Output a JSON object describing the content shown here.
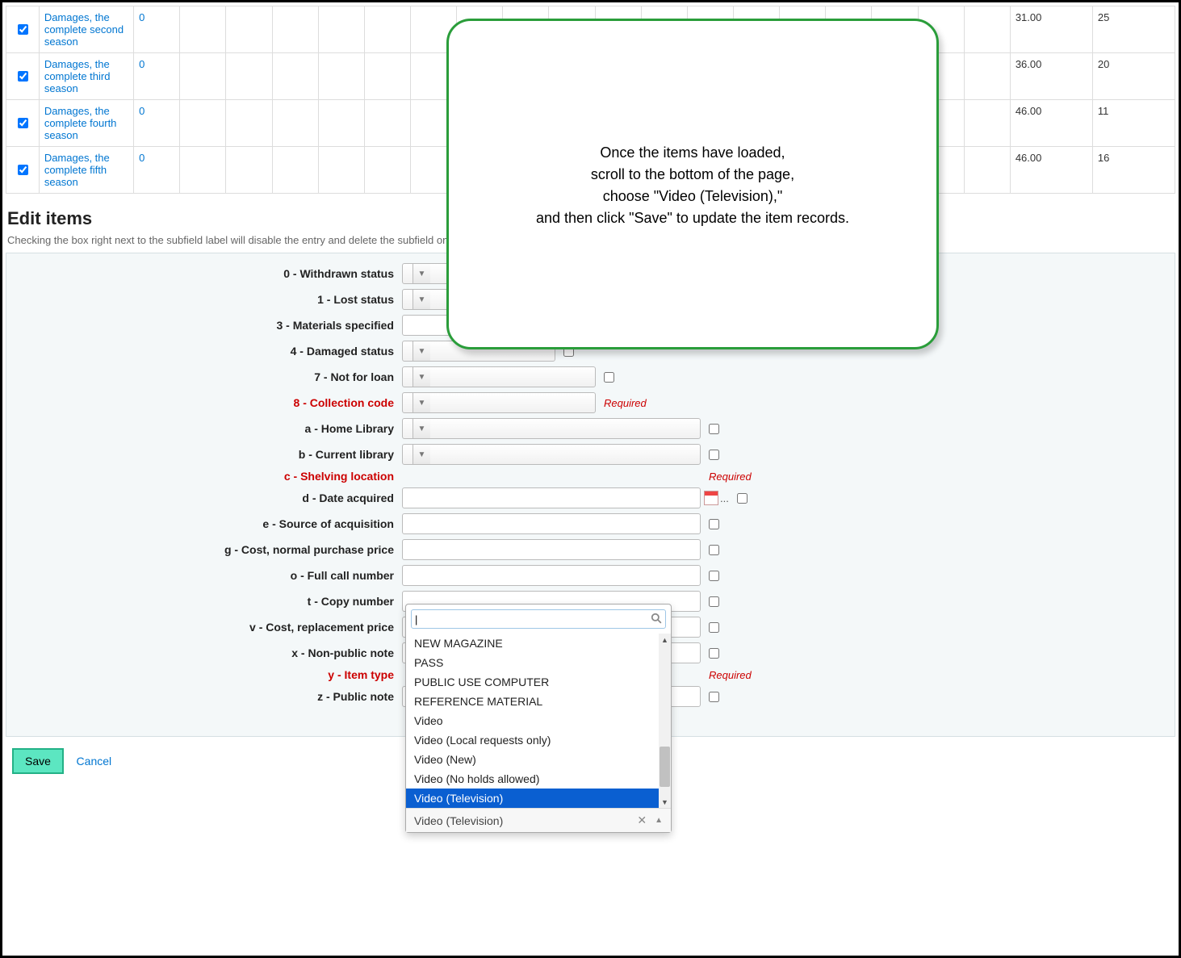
{
  "callout": {
    "line1": "Once the items have loaded,",
    "line2": "scroll to the bottom of the page,",
    "line3": "choose \"Video (Television),\"",
    "line4": "and then click \"Save\" to update the item records."
  },
  "table_rows": [
    {
      "title": "Damages, the complete second season",
      "qty": "0",
      "price": "31.00",
      "count": "25"
    },
    {
      "title": "Damages, the complete third season",
      "qty": "0",
      "price": "36.00",
      "count": "20"
    },
    {
      "title": "Damages, the complete fourth season",
      "qty": "0",
      "price": "46.00",
      "count": "11"
    },
    {
      "title": "Damages, the complete fifth season",
      "qty": "0",
      "price": "46.00",
      "count": "16"
    }
  ],
  "section_title": "Edit items",
  "help_text": "Checking the box right next to the subfield label will disable the entry and delete the subfield on all selected items. Leave fields blank to make no change.",
  "required_text": "Required",
  "fields": {
    "f0": "0 - Withdrawn status",
    "f1": "1 - Lost status",
    "f3": "3 - Materials specified",
    "f4": "4 - Damaged status",
    "f7": "7 - Not for loan",
    "f8": "8 - Collection code",
    "fa": "a - Home Library",
    "fb": "b - Current library",
    "fc": "c - Shelving location",
    "fd": "d - Date acquired",
    "fe": "e - Source of acquisition",
    "fg": "g - Cost, normal purchase price",
    "fo": "o - Full call number",
    "ft": "t - Copy number",
    "fv": "v - Cost, replacement price",
    "fx": "x - Non-public note",
    "fy": "y - Item type",
    "fz": "z - Public note"
  },
  "combo": {
    "selected_display": "Video (Television)",
    "options": [
      "NEW MAGAZINE",
      "PASS",
      "PUBLIC USE COMPUTER",
      "REFERENCE MATERIAL",
      "Video",
      "Video (Local requests only)",
      "Video (New)",
      "Video (No holds allowed)",
      "Video (Television)"
    ],
    "selected_index": 8
  },
  "buttons": {
    "save": "Save",
    "cancel": "Cancel"
  }
}
